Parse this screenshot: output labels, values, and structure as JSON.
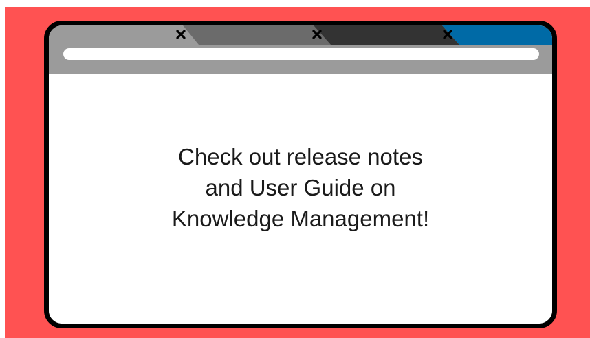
{
  "colors": {
    "background": "#ff5252",
    "frame": "#000000",
    "toolbar": "#9b9b9b",
    "tab_1": "#9b9b9b",
    "tab_2": "#6b6b6b",
    "tab_3": "#333333",
    "tab_4": "#006aa6",
    "url_field": "#ffffff",
    "content": "#ffffff",
    "text": "#1a1a1a"
  },
  "tabs": [
    {
      "icon": "close-icon"
    },
    {
      "icon": "close-icon"
    },
    {
      "icon": "close-icon"
    },
    {
      "icon": null
    }
  ],
  "address_bar": {
    "value": ""
  },
  "message": {
    "line_1": "Check out release notes",
    "line_2": "and User Guide on",
    "line_3": "Knowledge Management!"
  }
}
